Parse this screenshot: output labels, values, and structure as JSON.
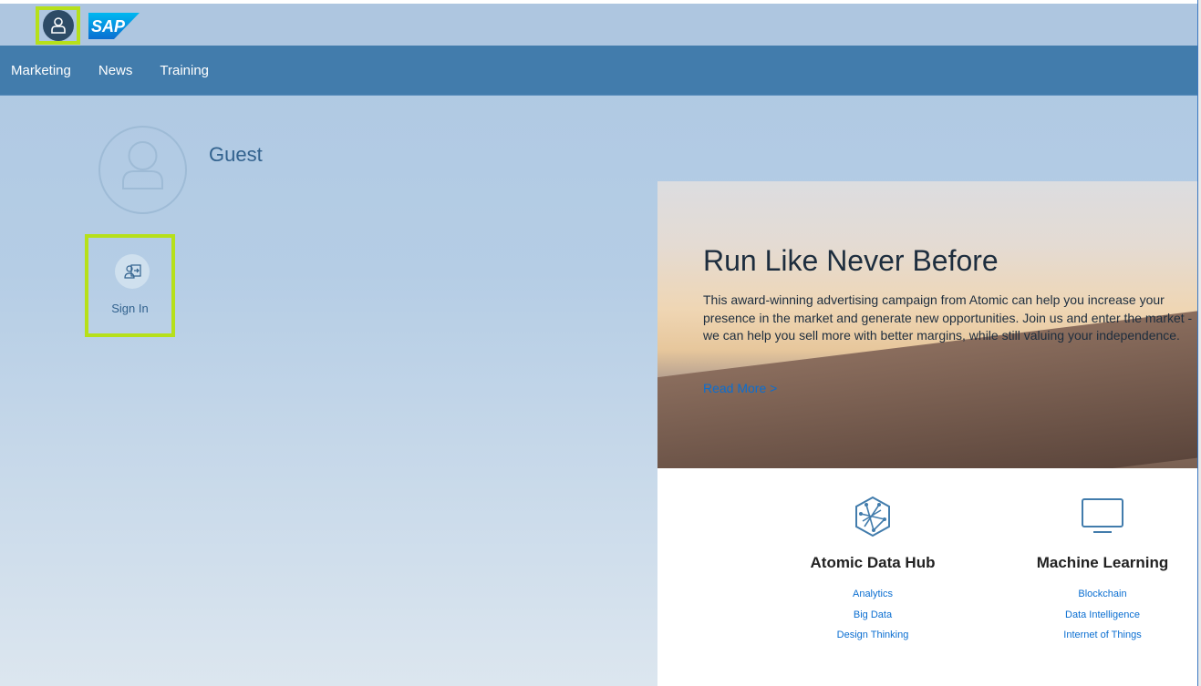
{
  "header": {
    "logo_text": "SAP",
    "brand_color": "#0a6ed1",
    "highlight_color": "#b6e01a"
  },
  "nav": {
    "items": [
      "Marketing",
      "News",
      "Training"
    ]
  },
  "user": {
    "name": "Guest",
    "sign_in_label": "Sign In"
  },
  "hero": {
    "title": "Run Like Never Before",
    "text": "This award-winning advertising campaign from Atomic can help you increase your presence in the market and generate new opportunities. Join us and enter the market - we can help you sell more with better margins, while still valuing your independence.",
    "link": "Read More >"
  },
  "features": [
    {
      "icon": "atom-network-icon",
      "title": "Atomic Data Hub",
      "links": [
        "Analytics",
        "Big Data",
        "Design Thinking"
      ]
    },
    {
      "icon": "monitor-icon",
      "title": "Machine Learning",
      "links": [
        "Blockchain",
        "Data Intelligence",
        "Internet of Things"
      ]
    }
  ]
}
